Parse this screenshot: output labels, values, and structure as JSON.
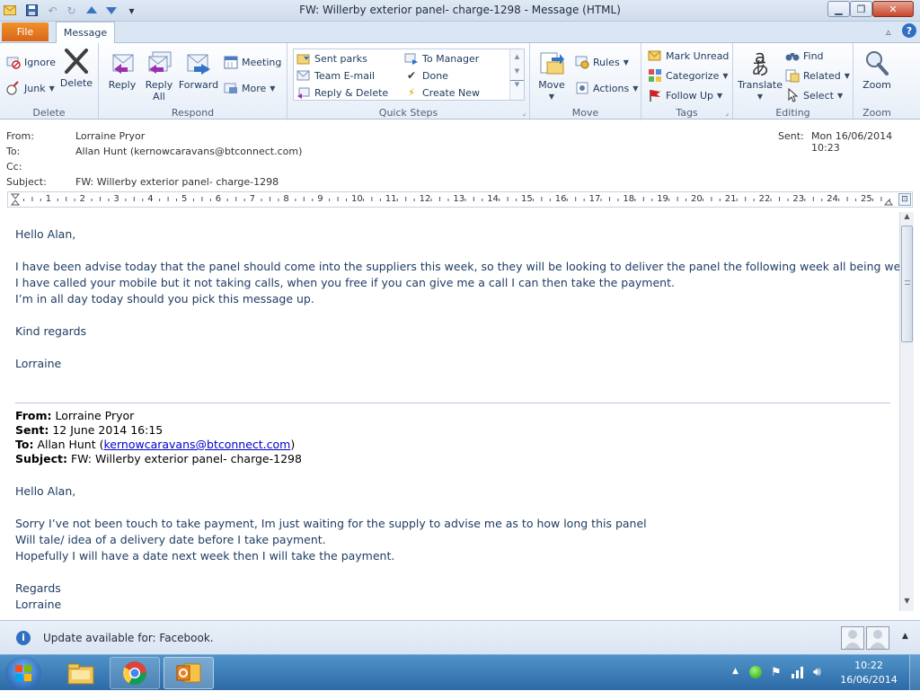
{
  "window": {
    "title": "FW: Willerby exterior panel- charge-1298  -  Message (HTML)",
    "icons": [
      "envelope-icon",
      "save-icon",
      "undo-icon",
      "redo-icon",
      "up-icon",
      "down-icon",
      "customize-icon"
    ],
    "controls": [
      "minimize",
      "maximize",
      "close"
    ]
  },
  "tabs": {
    "file": "File",
    "message": "Message"
  },
  "ribbon": {
    "delete_group": {
      "label": "Delete",
      "ignore": "Ignore",
      "junk": "Junk",
      "delete": "Delete"
    },
    "respond_group": {
      "label": "Respond",
      "reply": "Reply",
      "reply_all_1": "Reply",
      "reply_all_2": "All",
      "forward": "Forward",
      "meeting": "Meeting",
      "more": "More"
    },
    "quick_steps": {
      "label": "Quick Steps",
      "items": [
        "Sent parks",
        "To Manager",
        "Team E-mail",
        "Done",
        "Reply & Delete",
        "Create New"
      ]
    },
    "move_group": {
      "label": "Move",
      "move": "Move",
      "rules": "Rules",
      "actions": "Actions"
    },
    "tags_group": {
      "label": "Tags",
      "mark_unread": "Mark Unread",
      "categorize": "Categorize",
      "follow_up": "Follow Up"
    },
    "editing_group": {
      "label": "Editing",
      "translate": "Translate",
      "find": "Find",
      "related": "Related",
      "select": "Select"
    },
    "zoom_group": {
      "label": "Zoom",
      "zoom": "Zoom"
    }
  },
  "headers": {
    "from_label": "From:",
    "from": "Lorraine Pryor",
    "to_label": "To:",
    "to": "Allan Hunt (kernowcaravans@btconnect.com)",
    "cc_label": "Cc:",
    "cc": "",
    "subject_label": "Subject:",
    "subject": "FW: Willerby exterior panel- charge-1298",
    "sent_label": "Sent:",
    "sent": "Mon 16/06/2014 10:23"
  },
  "ruler": {
    "marks": [
      "1",
      "2",
      "3",
      "4",
      "5",
      "6",
      "7",
      "8",
      "9",
      "10",
      "11",
      "12",
      "13",
      "14",
      "15",
      "16",
      "17",
      "18",
      "19",
      "20",
      "21",
      "22",
      "23",
      "24",
      "25"
    ]
  },
  "message": {
    "greeting": "Hello Alan,",
    "line1": "I have been advise today that the panel should come into the suppliers this week, so they will be looking to deliver the panel the following week all being well.",
    "line2": "I have called your mobile but it not taking calls, when you free if you can give me a call I can then take the payment.",
    "line3": "I’m in all day today should you pick this message up.",
    "closing": "Kind regards",
    "signature": "Lorraine"
  },
  "forwarded": {
    "from_label": "From:",
    "from": "Lorraine Pryor",
    "sent_label": "Sent:",
    "sent": "12 June 2014 16:15",
    "to_label": "To:",
    "to_name": "Allan Hunt (",
    "to_email": "kernowcaravans@btconnect.com",
    "to_close": ")",
    "subject_label": "Subject:",
    "subject": "FW: Willerby exterior panel- charge-1298",
    "greeting": "Hello Alan,",
    "line1": "Sorry I’ve not been touch to take payment, Im just waiting for the supply to advise me as to how long this panel",
    "line2": "Will tale/ idea of a delivery date before I take payment.",
    "line3": "Hopefully I will have a date next week then I will take the payment.",
    "closing": "Regards",
    "signature": "Lorraine"
  },
  "status": {
    "text": "Update available for: Facebook."
  },
  "taskbar": {
    "time": "10:22",
    "date": "16/06/2014"
  }
}
